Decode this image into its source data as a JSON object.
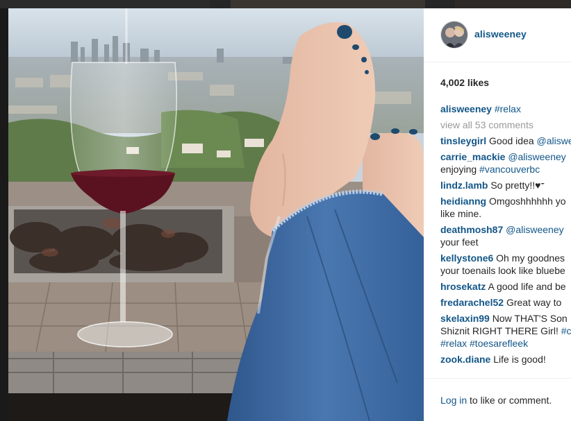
{
  "post": {
    "username": "alisweeney",
    "likes": "4,002 likes",
    "caption": {
      "user": "alisweeney",
      "tag": "#relax"
    },
    "view_all": "view all 53 comments",
    "comments": [
      {
        "user": "tinsleygirl",
        "lines": [
          [
            {
              "t": "Good idea "
            },
            {
              "t": "@alisweeney",
              "link": true
            }
          ]
        ]
      },
      {
        "user": "carrie_mackie",
        "lines": [
          [
            {
              "t": "@alisweeney",
              "link": true
            }
          ],
          [
            {
              "t": "enjoying "
            },
            {
              "t": "#vancouverbc",
              "link": true
            }
          ]
        ]
      },
      {
        "user": "lindz.lamb",
        "lines": [
          [
            {
              "t": "So pretty!!♥𝄻"
            }
          ]
        ]
      },
      {
        "user": "heidianng",
        "lines": [
          [
            {
              "t": "Omgoshhhhhh yo"
            }
          ],
          [
            {
              "t": "like mine."
            }
          ]
        ]
      },
      {
        "user": "deathmosh87",
        "lines": [
          [
            {
              "t": "@alisweeney",
              "link": true
            }
          ],
          [
            {
              "t": "your feet"
            }
          ]
        ]
      },
      {
        "user": "kellystone6",
        "lines": [
          [
            {
              "t": "Oh my goodnes"
            }
          ],
          [
            {
              "t": "your toenails look like bluebe"
            }
          ]
        ]
      },
      {
        "user": "hrosekatz",
        "lines": [
          [
            {
              "t": "A good life and be"
            }
          ]
        ]
      },
      {
        "user": "fredarachel52",
        "lines": [
          [
            {
              "t": "Great way to"
            }
          ]
        ]
      },
      {
        "user": "skelaxin99",
        "lines": [
          [
            {
              "t": "Now THAT'S Son"
            }
          ],
          [
            {
              "t": "Shiznit RIGHT THERE Girl! "
            },
            {
              "t": "#c",
              "link": true
            }
          ],
          [
            {
              "t": "#relax #toesarefleek",
              "link": true
            }
          ]
        ]
      },
      {
        "user": "zook.diane",
        "lines": [
          [
            {
              "t": "Life is good!"
            }
          ]
        ]
      }
    ],
    "login_link": "Log in",
    "login_text": " to like or comment."
  },
  "photo": {
    "subject": "wine glass and crossed bare feet with blue nail polish on a tiled fire pit ledge overlooking a city"
  },
  "colors": {
    "link": "#125688",
    "text": "#262626",
    "muted": "#999999",
    "nail_polish": "#1f4a6e",
    "denim": "#3f6aa3"
  }
}
